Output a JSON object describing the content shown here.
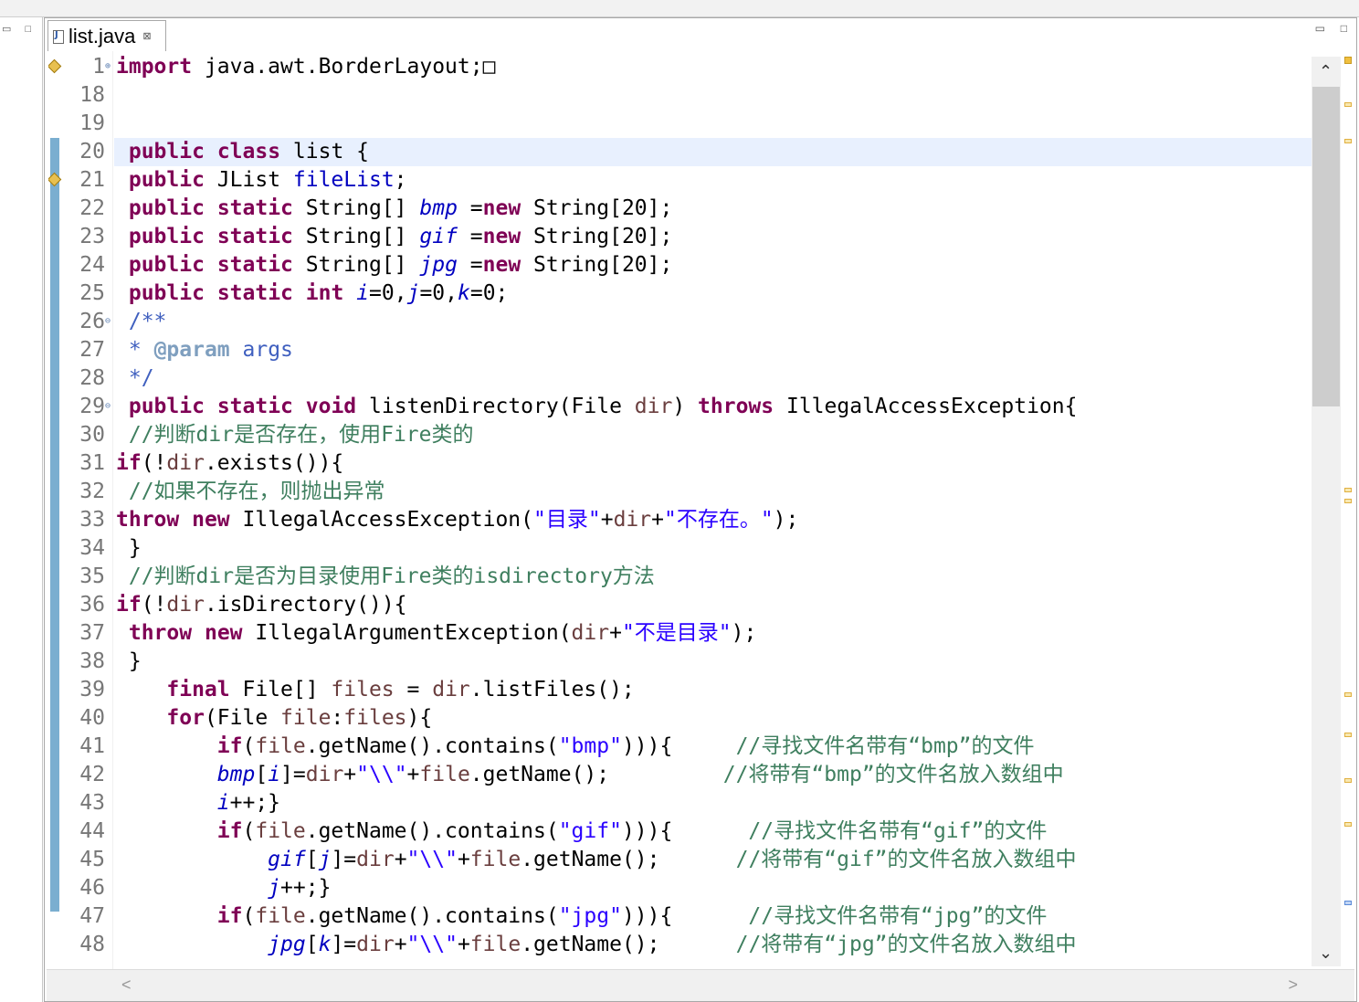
{
  "window": {
    "minimize": "▭",
    "maximize": "□"
  },
  "tab": {
    "label": "list.java",
    "close": "⊠"
  },
  "scroll": {
    "up": "⌃",
    "down": "⌄",
    "left": "<",
    "right": ">"
  },
  "colors": {
    "keyword": "#7f0055",
    "field": "#0000c0",
    "string": "#2a00ff",
    "comment": "#3f7f5f",
    "javadoc": "#3f5fbf",
    "current_line": "#e8f0fe"
  },
  "lines": [
    {
      "n": "1",
      "fold": "⊕",
      "warn": true,
      "tokens": [
        [
          "kw",
          "import"
        ],
        [
          "plain",
          " java.awt.BorderLayout;"
        ],
        [
          "plain",
          "□"
        ]
      ]
    },
    {
      "n": "18",
      "tokens": []
    },
    {
      "n": "19",
      "tokens": []
    },
    {
      "n": "20",
      "current": true,
      "tokens": [
        [
          "plain",
          " "
        ],
        [
          "kw",
          "public"
        ],
        [
          "plain",
          " "
        ],
        [
          "kw",
          "class"
        ],
        [
          "plain",
          " list {"
        ]
      ]
    },
    {
      "n": "21",
      "warn": true,
      "tokens": [
        [
          "plain",
          " "
        ],
        [
          "kw",
          "public"
        ],
        [
          "plain",
          " JList "
        ],
        [
          "fld",
          "fileList"
        ],
        [
          "plain",
          ";"
        ]
      ]
    },
    {
      "n": "22",
      "tokens": [
        [
          "plain",
          " "
        ],
        [
          "kw",
          "public"
        ],
        [
          "plain",
          " "
        ],
        [
          "kw",
          "static"
        ],
        [
          "plain",
          " String[] "
        ],
        [
          "sfld",
          "bmp"
        ],
        [
          "plain",
          " ="
        ],
        [
          "kw",
          "new"
        ],
        [
          "plain",
          " String[20];"
        ]
      ]
    },
    {
      "n": "23",
      "tokens": [
        [
          "plain",
          " "
        ],
        [
          "kw",
          "public"
        ],
        [
          "plain",
          " "
        ],
        [
          "kw",
          "static"
        ],
        [
          "plain",
          " String[] "
        ],
        [
          "sfld",
          "gif"
        ],
        [
          "plain",
          " ="
        ],
        [
          "kw",
          "new"
        ],
        [
          "plain",
          " String[20];"
        ]
      ]
    },
    {
      "n": "24",
      "tokens": [
        [
          "plain",
          " "
        ],
        [
          "kw",
          "public"
        ],
        [
          "plain",
          " "
        ],
        [
          "kw",
          "static"
        ],
        [
          "plain",
          " String[] "
        ],
        [
          "sfld",
          "jpg"
        ],
        [
          "plain",
          " ="
        ],
        [
          "kw",
          "new"
        ],
        [
          "plain",
          " String[20];"
        ]
      ]
    },
    {
      "n": "25",
      "tokens": [
        [
          "plain",
          " "
        ],
        [
          "kw",
          "public"
        ],
        [
          "plain",
          " "
        ],
        [
          "kw",
          "static"
        ],
        [
          "plain",
          " "
        ],
        [
          "kw",
          "int"
        ],
        [
          "plain",
          " "
        ],
        [
          "sfld",
          "i"
        ],
        [
          "plain",
          "=0,"
        ],
        [
          "sfld",
          "j"
        ],
        [
          "plain",
          "=0,"
        ],
        [
          "sfld",
          "k"
        ],
        [
          "plain",
          "=0;"
        ]
      ]
    },
    {
      "n": "26",
      "fold": "⊖",
      "tokens": [
        [
          "plain",
          " "
        ],
        [
          "doc",
          "/**"
        ]
      ]
    },
    {
      "n": "27",
      "tokens": [
        [
          "plain",
          " "
        ],
        [
          "doc",
          "* "
        ],
        [
          "tag",
          "@param"
        ],
        [
          "doc",
          " args"
        ]
      ]
    },
    {
      "n": "28",
      "tokens": [
        [
          "plain",
          " "
        ],
        [
          "doc",
          "*/"
        ]
      ]
    },
    {
      "n": "29",
      "fold": "⊖",
      "tokens": [
        [
          "plain",
          " "
        ],
        [
          "kw",
          "public"
        ],
        [
          "plain",
          " "
        ],
        [
          "kw",
          "static"
        ],
        [
          "plain",
          " "
        ],
        [
          "kw",
          "void"
        ],
        [
          "plain",
          " listenDirectory(File "
        ],
        [
          "param",
          "dir"
        ],
        [
          "plain",
          ") "
        ],
        [
          "kw",
          "throws"
        ],
        [
          "plain",
          " IllegalAccessException{"
        ]
      ]
    },
    {
      "n": "30",
      "tokens": [
        [
          "plain",
          " "
        ],
        [
          "cmt",
          "//判断dir是否存在，使用Fire类的"
        ]
      ]
    },
    {
      "n": "31",
      "tokens": [
        [
          "kw",
          "if"
        ],
        [
          "plain",
          "(!"
        ],
        [
          "param",
          "dir"
        ],
        [
          "plain",
          ".exists()){"
        ]
      ]
    },
    {
      "n": "32",
      "tokens": [
        [
          "plain",
          " "
        ],
        [
          "cmt",
          "//如果不存在，则抛出异常"
        ]
      ]
    },
    {
      "n": "33",
      "tokens": [
        [
          "kw",
          "throw"
        ],
        [
          "plain",
          " "
        ],
        [
          "kw",
          "new"
        ],
        [
          "plain",
          " IllegalAccessException("
        ],
        [
          "str",
          "\"目录\""
        ],
        [
          "plain",
          "+"
        ],
        [
          "param",
          "dir"
        ],
        [
          "plain",
          "+"
        ],
        [
          "str",
          "\"不存在。\""
        ],
        [
          "plain",
          ");"
        ]
      ]
    },
    {
      "n": "34",
      "tokens": [
        [
          "plain",
          " }"
        ]
      ]
    },
    {
      "n": "35",
      "tokens": [
        [
          "plain",
          " "
        ],
        [
          "cmt",
          "//判断dir是否为目录使用Fire类的isdirectory方法"
        ]
      ]
    },
    {
      "n": "36",
      "tokens": [
        [
          "kw",
          "if"
        ],
        [
          "plain",
          "(!"
        ],
        [
          "param",
          "dir"
        ],
        [
          "plain",
          ".isDirectory()){"
        ]
      ]
    },
    {
      "n": "37",
      "tokens": [
        [
          "plain",
          " "
        ],
        [
          "kw",
          "throw"
        ],
        [
          "plain",
          " "
        ],
        [
          "kw",
          "new"
        ],
        [
          "plain",
          " IllegalArgumentException("
        ],
        [
          "param",
          "dir"
        ],
        [
          "plain",
          "+"
        ],
        [
          "str",
          "\"不是目录\""
        ],
        [
          "plain",
          ");"
        ]
      ]
    },
    {
      "n": "38",
      "tokens": [
        [
          "plain",
          " }"
        ]
      ]
    },
    {
      "n": "39",
      "tokens": [
        [
          "plain",
          "    "
        ],
        [
          "kw",
          "final"
        ],
        [
          "plain",
          " File[] "
        ],
        [
          "param",
          "files"
        ],
        [
          "plain",
          " = "
        ],
        [
          "param",
          "dir"
        ],
        [
          "plain",
          ".listFiles();"
        ]
      ]
    },
    {
      "n": "40",
      "tokens": [
        [
          "plain",
          "    "
        ],
        [
          "kw",
          "for"
        ],
        [
          "plain",
          "(File "
        ],
        [
          "param",
          "file"
        ],
        [
          "plain",
          ":"
        ],
        [
          "param",
          "files"
        ],
        [
          "plain",
          "){"
        ]
      ]
    },
    {
      "n": "41",
      "tokens": [
        [
          "plain",
          "        "
        ],
        [
          "kw",
          "if"
        ],
        [
          "plain",
          "("
        ],
        [
          "param",
          "file"
        ],
        [
          "plain",
          ".getName().contains("
        ],
        [
          "str",
          "\"bmp\""
        ],
        [
          "plain",
          "))){     "
        ],
        [
          "cmt",
          "//寻找文件名带有“bmp”的文件"
        ]
      ]
    },
    {
      "n": "42",
      "tokens": [
        [
          "plain",
          "        "
        ],
        [
          "sfld",
          "bmp"
        ],
        [
          "plain",
          "["
        ],
        [
          "sfld",
          "i"
        ],
        [
          "plain",
          "]="
        ],
        [
          "param",
          "dir"
        ],
        [
          "plain",
          "+"
        ],
        [
          "str",
          "\"\\\\\""
        ],
        [
          "plain",
          "+"
        ],
        [
          "param",
          "file"
        ],
        [
          "plain",
          ".getName();         "
        ],
        [
          "cmt",
          "//将带有“bmp”的文件名放入数组中"
        ]
      ]
    },
    {
      "n": "43",
      "tokens": [
        [
          "plain",
          "        "
        ],
        [
          "sfld",
          "i"
        ],
        [
          "plain",
          "++;}"
        ]
      ]
    },
    {
      "n": "44",
      "tokens": [
        [
          "plain",
          "        "
        ],
        [
          "kw",
          "if"
        ],
        [
          "plain",
          "("
        ],
        [
          "param",
          "file"
        ],
        [
          "plain",
          ".getName().contains("
        ],
        [
          "str",
          "\"gif\""
        ],
        [
          "plain",
          "))){      "
        ],
        [
          "cmt",
          "//寻找文件名带有“gif”的文件"
        ]
      ]
    },
    {
      "n": "45",
      "tokens": [
        [
          "plain",
          "            "
        ],
        [
          "sfld",
          "gif"
        ],
        [
          "plain",
          "["
        ],
        [
          "sfld",
          "j"
        ],
        [
          "plain",
          "]="
        ],
        [
          "param",
          "dir"
        ],
        [
          "plain",
          "+"
        ],
        [
          "str",
          "\"\\\\\""
        ],
        [
          "plain",
          "+"
        ],
        [
          "param",
          "file"
        ],
        [
          "plain",
          ".getName();      "
        ],
        [
          "cmt",
          "//将带有“gif”的文件名放入数组中"
        ]
      ]
    },
    {
      "n": "46",
      "tokens": [
        [
          "plain",
          "            "
        ],
        [
          "sfld",
          "j"
        ],
        [
          "plain",
          "++;}"
        ]
      ]
    },
    {
      "n": "47",
      "tokens": [
        [
          "plain",
          "        "
        ],
        [
          "kw",
          "if"
        ],
        [
          "plain",
          "("
        ],
        [
          "param",
          "file"
        ],
        [
          "plain",
          ".getName().contains("
        ],
        [
          "str",
          "\"jpg\""
        ],
        [
          "plain",
          "))){      "
        ],
        [
          "cmt",
          "//寻找文件名带有“jpg”的文件"
        ]
      ]
    },
    {
      "n": "48",
      "tokens": [
        [
          "plain",
          "            "
        ],
        [
          "sfld",
          "jpg"
        ],
        [
          "plain",
          "["
        ],
        [
          "sfld",
          "k"
        ],
        [
          "plain",
          "]="
        ],
        [
          "param",
          "dir"
        ],
        [
          "plain",
          "+"
        ],
        [
          "str",
          "\"\\\\\""
        ],
        [
          "plain",
          "+"
        ],
        [
          "param",
          "file"
        ],
        [
          "plain",
          ".getName();      "
        ],
        [
          "cmt",
          "//将带有“jpg”的文件名放入数组中"
        ]
      ]
    }
  ]
}
